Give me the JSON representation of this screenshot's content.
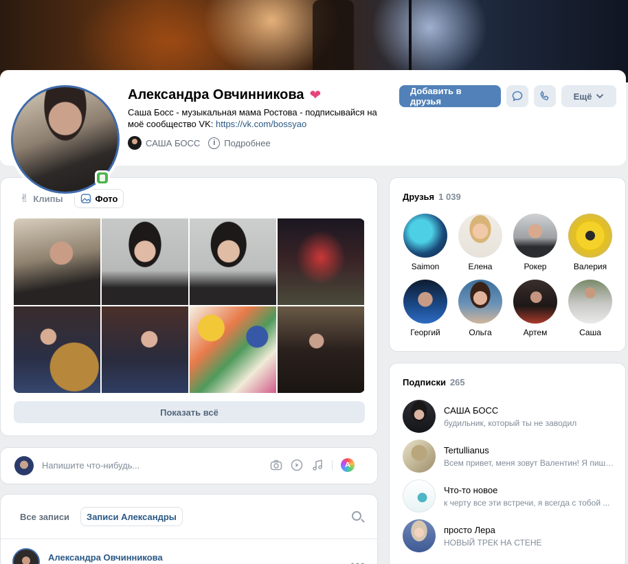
{
  "profile": {
    "name": "Александра Овчинникова",
    "status_text": "Саша Босс - музыкальная мама Ростова - подписывайся на моё сообщество VK:",
    "status_link": "https://vk.com/bossyao",
    "community": "САША БОСС",
    "more_info": "Подробнее",
    "add_friend": "Добавить в друзья",
    "more": "Ещё",
    "online_color": "#4bb34b",
    "accent_color": "#5181b8"
  },
  "photos": {
    "tabs": [
      "Клипы",
      "Фото"
    ],
    "active_tab": "Фото",
    "show_all": "Показать всё"
  },
  "composer": {
    "placeholder": "Напишите что-нибудь..."
  },
  "wall": {
    "tabs": [
      "Все записи",
      "Записи Александры"
    ],
    "active_tab": "Записи Александры",
    "post_author": "Александра Овчинникова",
    "more_dots": "•••"
  },
  "friends": {
    "title": "Друзья",
    "count": "1 039",
    "items": [
      {
        "name": "Saimon"
      },
      {
        "name": "Елена"
      },
      {
        "name": "Рокер"
      },
      {
        "name": "Валерия"
      },
      {
        "name": "Георгий"
      },
      {
        "name": "Ольга"
      },
      {
        "name": "Артем"
      },
      {
        "name": "Саша"
      }
    ]
  },
  "subscriptions": {
    "title": "Подписки",
    "count": "265",
    "items": [
      {
        "name": "САША БОСС",
        "desc": "будильник, который ты не заводил"
      },
      {
        "name": "Tertullianus",
        "desc": "Всем привет, меня зовут Валентин! Я пишу..."
      },
      {
        "name": "Что-то новое",
        "desc": "к черту все эти встречи, я всегда с тобой ..."
      },
      {
        "name": "просто Лера",
        "desc": "НОВЫЙ ТРЕК НА СТЕНЕ"
      }
    ]
  }
}
